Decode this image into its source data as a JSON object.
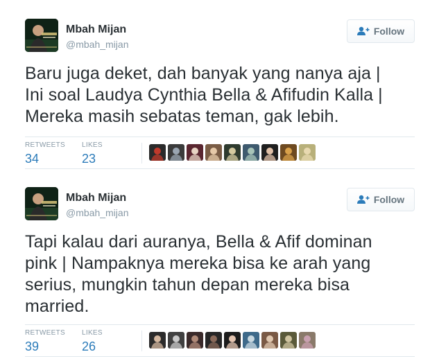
{
  "tweets": [
    {
      "author": {
        "name": "Mbah Mijan",
        "handle": "@mbah_mijan",
        "avatar_icon": "user-avatar"
      },
      "follow_label": "Follow",
      "text": "Baru juga deket, dah banyak yang nanya aja |\nIni soal Laudya Cynthia Bella &  Afifudin Kalla |\nMereka masih sebatas teman, gak lebih.",
      "stats": {
        "retweets_label": "RETWEETS",
        "retweets": "34",
        "likes_label": "LIKES",
        "likes": "23"
      },
      "likers": [
        {
          "color": "#2a2a2a",
          "accent": "#c0392b"
        },
        {
          "color": "#3b3b3b",
          "accent": "#9aa5b1"
        },
        {
          "color": "#5a2630",
          "accent": "#e8d4c4"
        },
        {
          "color": "#7a5c45",
          "accent": "#e6c9a8"
        },
        {
          "color": "#2e3a2e",
          "accent": "#d4c9a0"
        },
        {
          "color": "#3e5a6e",
          "accent": "#a8c4b8"
        },
        {
          "color": "#1f1f1f",
          "accent": "#e0c0a8"
        },
        {
          "color": "#6e4a20",
          "accent": "#d9a14a"
        },
        {
          "color": "#b8b07a",
          "accent": "#e8d9b0"
        }
      ]
    },
    {
      "author": {
        "name": "Mbah Mijan",
        "handle": "@mbah_mijan",
        "avatar_icon": "user-avatar"
      },
      "follow_label": "Follow",
      "text": "Tapi kalau dari auranya, Bella & Afif dominan\npink | Nampaknya mereka bisa ke arah yang\nserius, mungkin tahun depan mereka bisa\nmarried.",
      "stats": {
        "retweets_label": "RETWEETS",
        "retweets": "39",
        "likes_label": "LIKES",
        "likes": "26"
      },
      "likers": [
        {
          "color": "#2b2b2b",
          "accent": "#d4b8a0"
        },
        {
          "color": "#404040",
          "accent": "#c9c9c9"
        },
        {
          "color": "#3a2a2a",
          "accent": "#b08a78"
        },
        {
          "color": "#262626",
          "accent": "#8a6a5a"
        },
        {
          "color": "#1c1c1c",
          "accent": "#e3c4b0"
        },
        {
          "color": "#3e6a8a",
          "accent": "#c8d8e0"
        },
        {
          "color": "#7a5a45",
          "accent": "#e0c8b0"
        },
        {
          "color": "#5a5a3a",
          "accent": "#cfc4a0"
        },
        {
          "color": "#8a7a6a",
          "accent": "#c9a0b0"
        }
      ]
    }
  ],
  "colors": {
    "link_blue": "#2b7bb9",
    "muted_gray": "#8899a6",
    "text": "#292f33",
    "border": "#e1e8ed"
  }
}
